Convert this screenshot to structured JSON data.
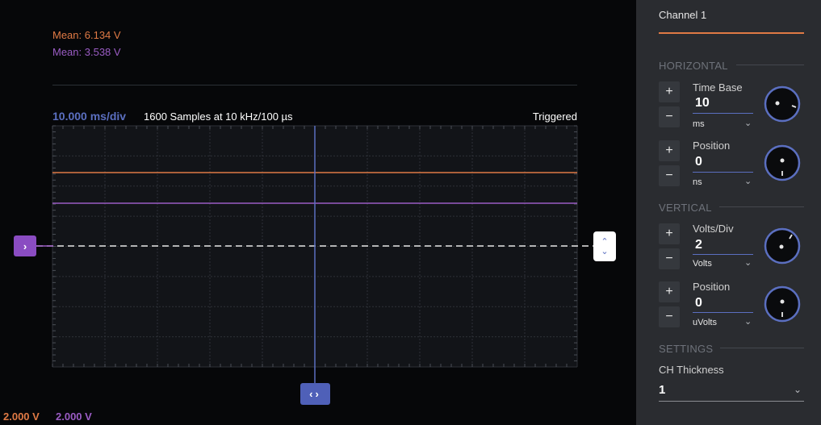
{
  "scope": {
    "mean_ch1": "Mean: 6.134 V",
    "mean_ch2": "Mean: 3.538 V",
    "time_per_div": "10.000 ms/div",
    "samples_info": "1600 Samples at 10 kHz/100 µs",
    "trigger_status": "Triggered",
    "ch1_scale": "2.000 V",
    "ch2_scale": "2.000 V",
    "colors": {
      "ch1": "#e07a45",
      "ch2": "#9a5cc4",
      "accent": "#5b6fc0",
      "grid": "#2e3137",
      "background": "#060709"
    },
    "trigger_button_icon": "chevron-right-icon",
    "level_button_icons": [
      "chevron-up-icon",
      "chevron-down-icon"
    ],
    "cursor_button_icons": [
      "chevron-left-icon",
      "chevron-right-icon"
    ]
  },
  "panel": {
    "channel_title": "Channel 1",
    "horizontal": {
      "section": "HORIZONTAL",
      "time_base": {
        "label": "Time Base",
        "value": "10",
        "unit": "ms"
      },
      "position": {
        "label": "Position",
        "value": "0",
        "unit": "ns"
      }
    },
    "vertical": {
      "section": "VERTICAL",
      "volts_div": {
        "label": "Volts/Div",
        "value": "2",
        "unit": "Volts"
      },
      "position": {
        "label": "Position",
        "value": "0",
        "unit": "uVolts"
      }
    },
    "settings": {
      "section": "SETTINGS",
      "ch_thickness": {
        "label": "CH Thickness",
        "value": "1"
      }
    },
    "plus_label": "+",
    "minus_label": "−"
  }
}
